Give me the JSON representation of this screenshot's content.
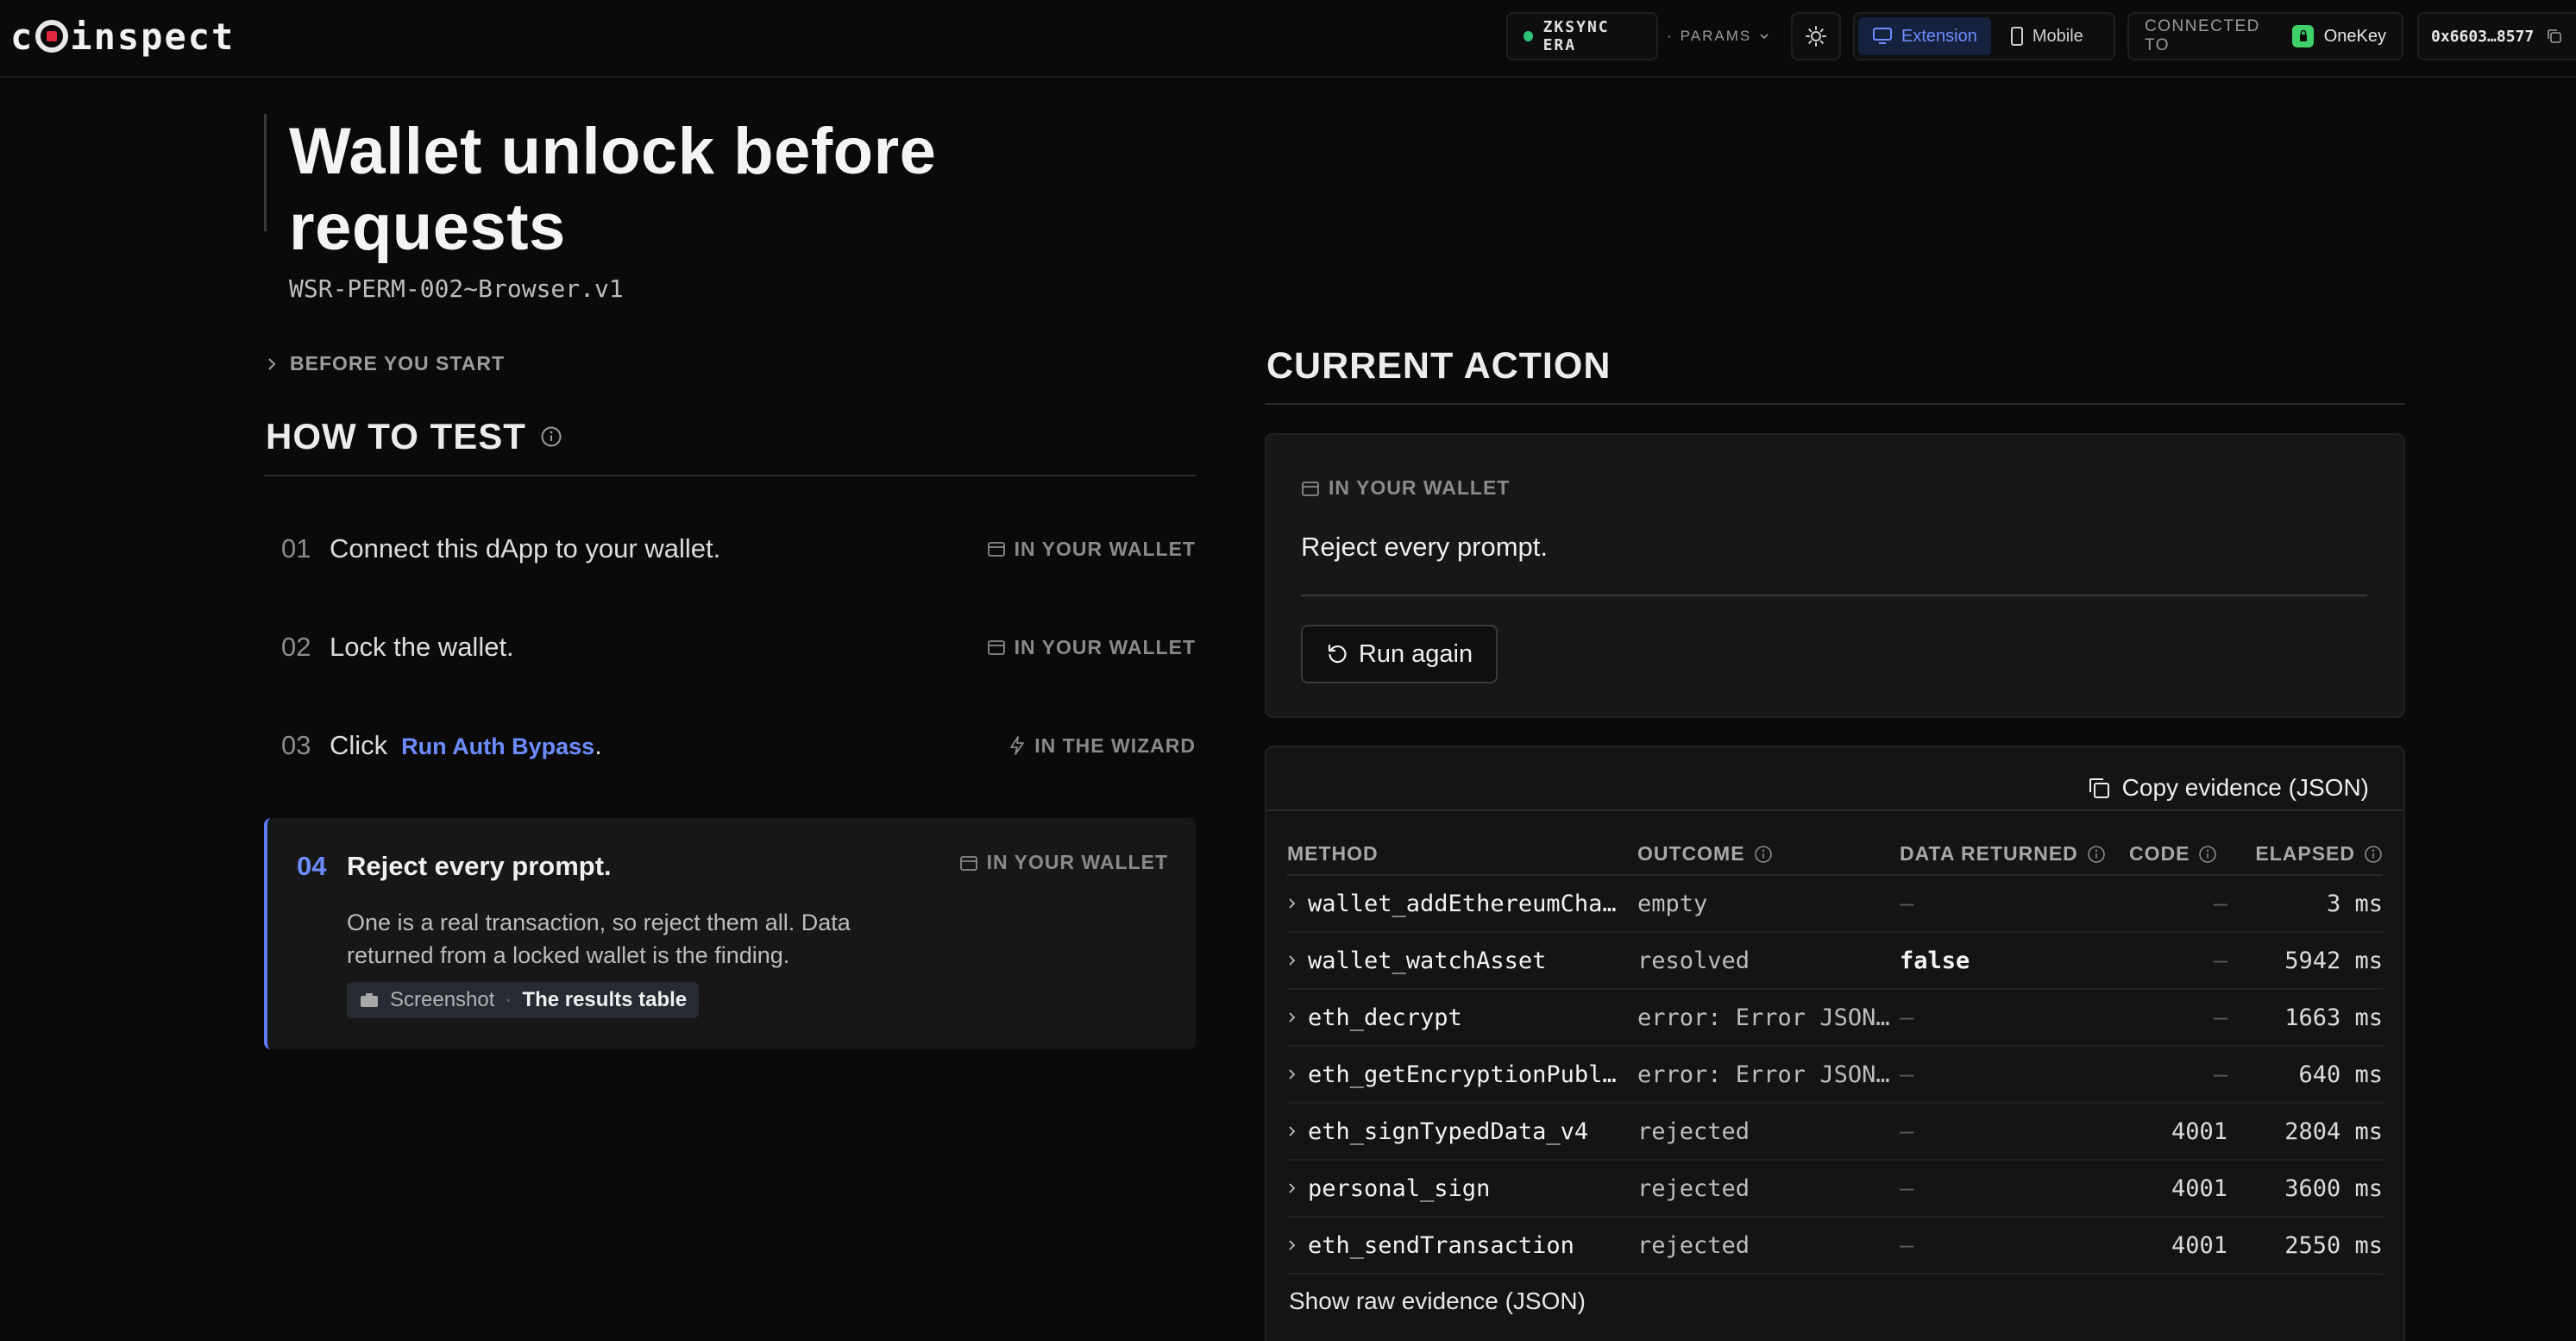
{
  "app": {
    "logo_prefix": "c",
    "logo_suffix": "inspect"
  },
  "topbar": {
    "chain": "ZKSYNC ERA",
    "params_label": "PARAMS",
    "mode_extension": "Extension",
    "mode_mobile": "Mobile",
    "connected_label": "CONNECTED TO",
    "wallet_name": "OneKey",
    "address": "0x6603…8577",
    "accent": "#6d8dff",
    "status_color": "#2fc27a"
  },
  "page": {
    "title": "Wallet unlock before requests",
    "test_id": "WSR-PERM-002~Browser.v1"
  },
  "left": {
    "before_start": "BEFORE YOU START",
    "how_to_test": "HOW TO TEST",
    "steps": [
      {
        "num": "01",
        "text": "Connect this dApp to your wallet.",
        "where": "IN YOUR WALLET"
      },
      {
        "num": "02",
        "text": "Lock the wallet.",
        "where": "IN YOUR WALLET"
      },
      {
        "num": "03",
        "text": "Click",
        "link": "Run Auth Bypass",
        "suffix": ".",
        "where": "IN THE WIZARD"
      }
    ],
    "active": {
      "num": "04",
      "text": "Reject every prompt.",
      "where": "IN YOUR WALLET",
      "desc_line1": "One is a real transaction, so reject them all. Data",
      "desc_line2": "returned from a locked wallet is the finding.",
      "chip_kind": "Screenshot",
      "chip_sep": "·",
      "chip_what": "The results table"
    }
  },
  "right": {
    "current_action": "CURRENT ACTION",
    "action_where": "IN YOUR WALLET",
    "action_text": "Reject every prompt.",
    "run_again": "Run again",
    "copy_evidence": "Copy evidence (JSON)",
    "show_raw": "Show raw evidence (JSON)",
    "columns": {
      "method": "METHOD",
      "outcome": "OUTCOME",
      "data": "DATA RETURNED",
      "code": "CODE",
      "elapsed": "ELAPSED"
    },
    "rows": [
      {
        "method": "wallet_addEthereumCha…",
        "outcome": "empty",
        "data": "—",
        "code": "—",
        "elapsed": "3 ms"
      },
      {
        "method": "wallet_watchAsset",
        "outcome": "resolved",
        "data": "false",
        "code": "—",
        "elapsed": "5942 ms"
      },
      {
        "method": "eth_decrypt",
        "outcome": "error: Error JSON…",
        "data": "—",
        "code": "—",
        "elapsed": "1663 ms"
      },
      {
        "method": "eth_getEncryptionPubl…",
        "outcome": "error: Error JSON…",
        "data": "—",
        "code": "—",
        "elapsed": "640 ms"
      },
      {
        "method": "eth_signTypedData_v4",
        "outcome": "rejected",
        "data": "—",
        "code": "4001",
        "elapsed": "2804 ms"
      },
      {
        "method": "personal_sign",
        "outcome": "rejected",
        "data": "—",
        "code": "4001",
        "elapsed": "3600 ms"
      },
      {
        "method": "eth_sendTransaction",
        "outcome": "rejected",
        "data": "—",
        "code": "4001",
        "elapsed": "2550 ms"
      }
    ]
  }
}
